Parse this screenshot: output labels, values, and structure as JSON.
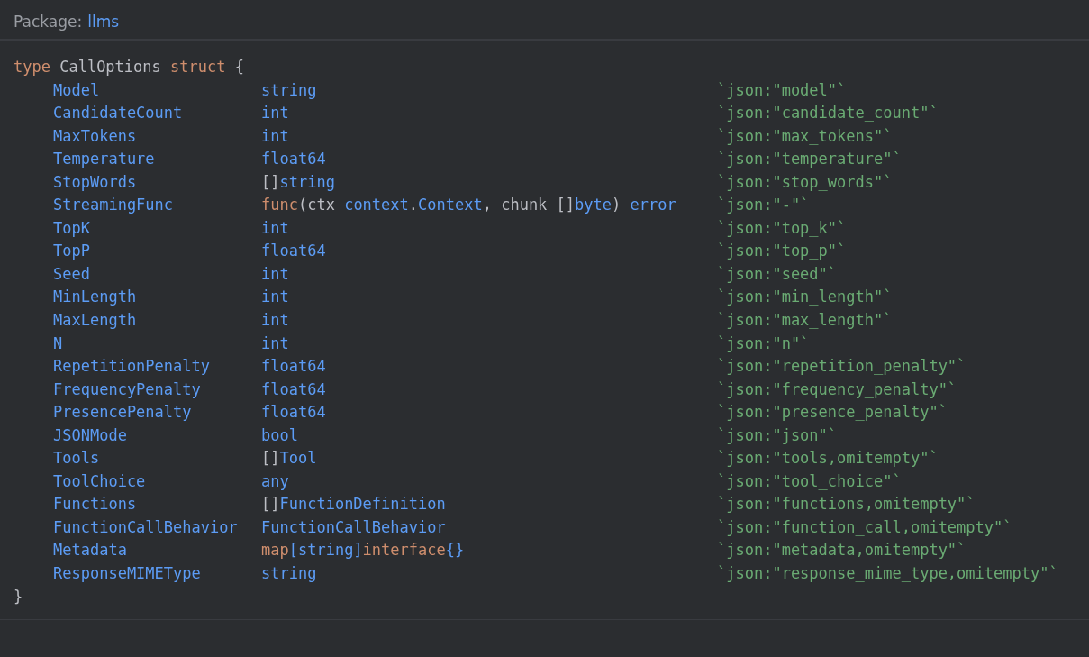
{
  "package": {
    "label": "Package:",
    "name": "llms"
  },
  "header": [
    {
      "kind": "keyword",
      "text": "type"
    },
    {
      "kind": "plain",
      "text": " CallOptions "
    },
    {
      "kind": "keyword",
      "text": "struct"
    },
    {
      "kind": "plain",
      "text": " {"
    }
  ],
  "fields": [
    {
      "name": "Model",
      "type": [
        {
          "kind": "type",
          "text": "string"
        }
      ],
      "tag": "`json:\"model\"`"
    },
    {
      "name": "CandidateCount",
      "type": [
        {
          "kind": "type",
          "text": "int"
        }
      ],
      "tag": "`json:\"candidate_count\"`"
    },
    {
      "name": "MaxTokens",
      "type": [
        {
          "kind": "type",
          "text": "int"
        }
      ],
      "tag": "`json:\"max_tokens\"`"
    },
    {
      "name": "Temperature",
      "type": [
        {
          "kind": "type",
          "text": "float64"
        }
      ],
      "tag": "`json:\"temperature\"`"
    },
    {
      "name": "StopWords",
      "type": [
        {
          "kind": "plain",
          "text": "[]"
        },
        {
          "kind": "type",
          "text": "string"
        }
      ],
      "tag": "`json:\"stop_words\"`"
    },
    {
      "name": "StreamingFunc",
      "type": [
        {
          "kind": "keyword",
          "text": "func"
        },
        {
          "kind": "plain",
          "text": "(ctx "
        },
        {
          "kind": "type",
          "text": "context"
        },
        {
          "kind": "plain",
          "text": "."
        },
        {
          "kind": "type",
          "text": "Context"
        },
        {
          "kind": "plain",
          "text": ", chunk []"
        },
        {
          "kind": "type",
          "text": "byte"
        },
        {
          "kind": "plain",
          "text": ") "
        },
        {
          "kind": "type",
          "text": "error"
        }
      ],
      "tag": "`json:\"-\"`"
    },
    {
      "name": "TopK",
      "type": [
        {
          "kind": "type",
          "text": "int"
        }
      ],
      "tag": "`json:\"top_k\"`"
    },
    {
      "name": "TopP",
      "type": [
        {
          "kind": "type",
          "text": "float64"
        }
      ],
      "tag": "`json:\"top_p\"`"
    },
    {
      "name": "Seed",
      "type": [
        {
          "kind": "type",
          "text": "int"
        }
      ],
      "tag": "`json:\"seed\"`"
    },
    {
      "name": "MinLength",
      "type": [
        {
          "kind": "type",
          "text": "int"
        }
      ],
      "tag": "`json:\"min_length\"`"
    },
    {
      "name": "MaxLength",
      "type": [
        {
          "kind": "type",
          "text": "int"
        }
      ],
      "tag": "`json:\"max_length\"`"
    },
    {
      "name": "N",
      "type": [
        {
          "kind": "type",
          "text": "int"
        }
      ],
      "tag": "`json:\"n\"`"
    },
    {
      "name": "RepetitionPenalty",
      "type": [
        {
          "kind": "type",
          "text": "float64"
        }
      ],
      "tag": "`json:\"repetition_penalty\"`"
    },
    {
      "name": "FrequencyPenalty",
      "type": [
        {
          "kind": "type",
          "text": "float64"
        }
      ],
      "tag": "`json:\"frequency_penalty\"`"
    },
    {
      "name": "PresencePenalty",
      "type": [
        {
          "kind": "type",
          "text": "float64"
        }
      ],
      "tag": "`json:\"presence_penalty\"`"
    },
    {
      "name": "JSONMode",
      "type": [
        {
          "kind": "type",
          "text": "bool"
        }
      ],
      "tag": "`json:\"json\"`"
    },
    {
      "name": "Tools",
      "type": [
        {
          "kind": "plain",
          "text": "[]"
        },
        {
          "kind": "type",
          "text": "Tool"
        }
      ],
      "tag": "`json:\"tools,omitempty\"`"
    },
    {
      "name": "ToolChoice",
      "type": [
        {
          "kind": "type",
          "text": "any"
        }
      ],
      "tag": "`json:\"tool_choice\"`"
    },
    {
      "name": "Functions",
      "type": [
        {
          "kind": "plain",
          "text": "[]"
        },
        {
          "kind": "type",
          "text": "FunctionDefinition"
        }
      ],
      "tag": "`json:\"functions,omitempty\"`"
    },
    {
      "name": "FunctionCallBehavior",
      "type": [
        {
          "kind": "type",
          "text": "FunctionCallBehavior"
        }
      ],
      "tag": "`json:\"function_call,omitempty\"`"
    },
    {
      "name": "Metadata",
      "type": [
        {
          "kind": "keyword",
          "text": "map"
        },
        {
          "kind": "type",
          "text": "[string]"
        },
        {
          "kind": "keyword",
          "text": "interface"
        },
        {
          "kind": "type",
          "text": "{}"
        }
      ],
      "tag": "`json:\"metadata,omitempty\"`"
    },
    {
      "name": "ResponseMIMEType",
      "type": [
        {
          "kind": "type",
          "text": "string"
        }
      ],
      "tag": "`json:\"response_mime_type,omitempty\"`"
    }
  ],
  "footer": "}"
}
